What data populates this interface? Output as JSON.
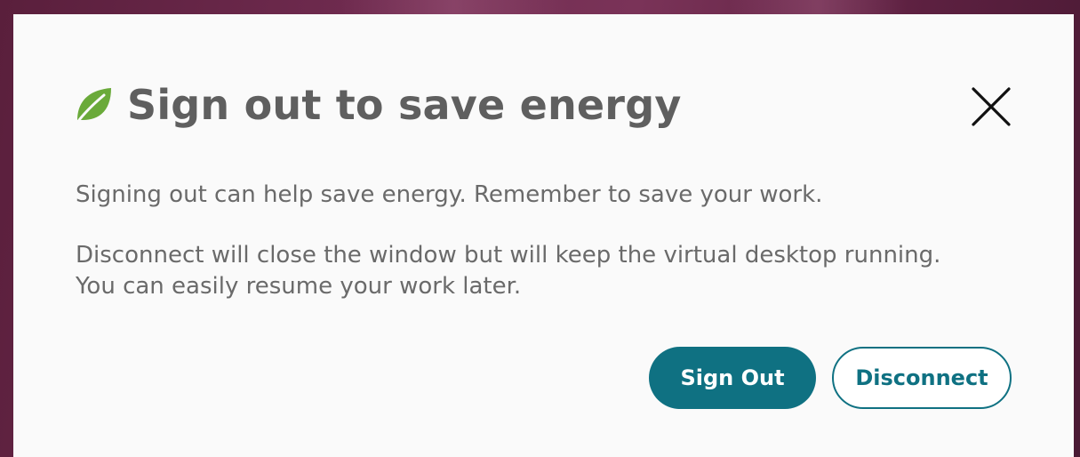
{
  "dialog": {
    "icon": "leaf-icon",
    "title": "Sign out to save energy",
    "close_icon": "close-icon",
    "paragraph1": "Signing out can help save energy. Remember to save your work.",
    "paragraph2_line1": "Disconnect will close the window but will keep the virtual desktop running.",
    "paragraph2_line2": "You can easily resume your work later.",
    "buttons": {
      "sign_out": "Sign Out",
      "disconnect": "Disconnect"
    }
  },
  "colors": {
    "accent": "#0f7182",
    "leaf": "#6aaa3a",
    "title_text": "#5f5f5f",
    "body_text": "#6a6a6a",
    "dialog_bg": "#fafafa",
    "backdrop": "#6e2a4e"
  }
}
